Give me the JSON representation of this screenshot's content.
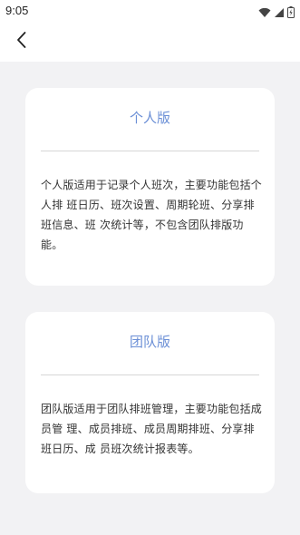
{
  "status_bar": {
    "time": "9:05",
    "icons": [
      "wifi-icon",
      "signal-icon",
      "battery-icon"
    ]
  },
  "app_bar": {
    "back_icon": "chevron-left-icon"
  },
  "plans": {
    "personal": {
      "title": "个人版",
      "description": "个人版适用于记录个人班次，主要功能包括个人排 班日历、班次设置、周期轮班、分享排班信息、班 次统计等，不包含团队排版功能。"
    },
    "team": {
      "title": "团队版",
      "description": "团队版适用于团队排班管理，主要功能包括成员管 理、成员排班、成员周期排班、分享排班日历、成 员班次统计报表等。"
    }
  },
  "colors": {
    "accent": "#6b8fd6",
    "background": "#f2f2f4",
    "card": "#ffffff"
  }
}
